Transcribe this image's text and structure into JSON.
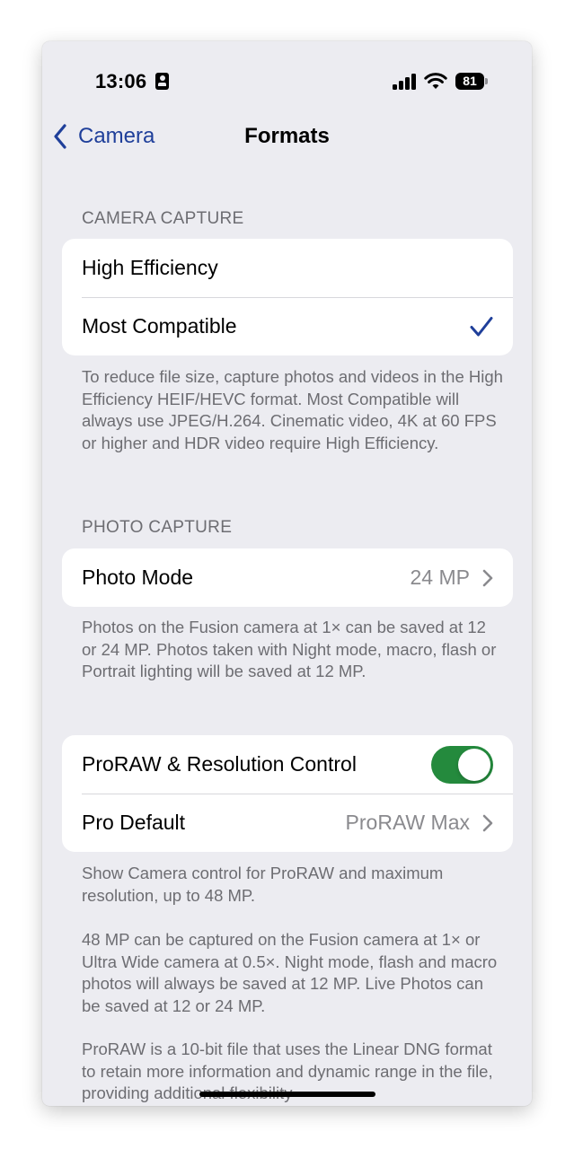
{
  "status_bar": {
    "time": "13:06",
    "battery": "81",
    "icons": [
      "id-card-icon",
      "signal-icon",
      "wifi-icon",
      "battery-icon"
    ]
  },
  "nav": {
    "back_label": "Camera",
    "title": "Formats",
    "back_icon": "chevron-left-icon"
  },
  "colors": {
    "accent": "#1f3f9a",
    "toggle_on": "#248a3d",
    "background": "#ececf1"
  },
  "camera_capture": {
    "header": "CAMERA CAPTURE",
    "options": [
      {
        "label": "High Efficiency",
        "selected": false
      },
      {
        "label": "Most Compatible",
        "selected": true
      }
    ],
    "footer": "To reduce file size, capture photos and videos in the High Efficiency HEIF/HEVC format. Most Compatible will always use JPEG/H.264. Cinematic video, 4K at 60 FPS or higher and HDR video require High Efficiency."
  },
  "photo_capture": {
    "header": "PHOTO CAPTURE",
    "photo_mode": {
      "label": "Photo Mode",
      "value": "24 MP"
    },
    "footer": "Photos on the Fusion camera at 1× can be saved at 12 or 24 MP. Photos taken with Night mode, macro, flash or Portrait lighting will be saved at 12 MP."
  },
  "proraw": {
    "toggle_row": {
      "label": "ProRAW & Resolution Control",
      "on": true
    },
    "pro_default": {
      "label": "Pro Default",
      "value": "ProRAW Max"
    },
    "footer_1": "Show Camera control for ProRAW and maximum resolution, up to 48 MP.",
    "footer_2": "48 MP can be captured on the Fusion camera at 1× or Ultra Wide camera at 0.5×. Night mode, flash and macro photos will always be saved at 12 MP. Live Photos can be saved at 12 or 24 MP.",
    "footer_3": "ProRAW is a 10-bit file that uses the Linear DNG format to retain more information and dynamic range in the file, providing additional flexibility"
  }
}
